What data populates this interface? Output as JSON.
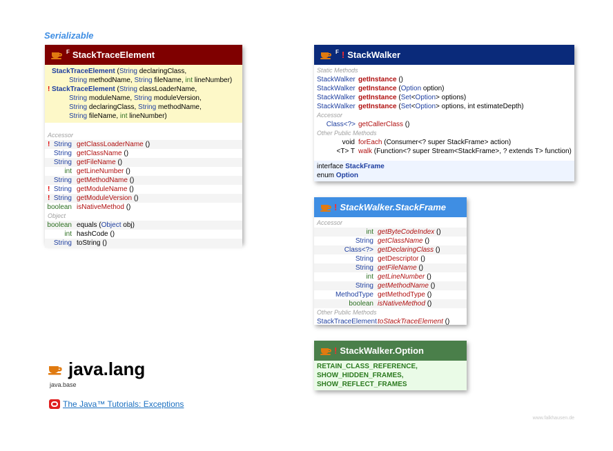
{
  "serializable_label": "Serializable",
  "icons": {
    "class": "coffee-cup-icon",
    "oracle": "oracle-logo-icon"
  },
  "colors": {
    "red_header": "#7f0000",
    "navy_header": "#0a2a7a",
    "blue_header": "#3f8ee3",
    "green_header": "#4a7f4a",
    "enum_bg": "#eafbe7",
    "ctor_bg": "#fdf8c8"
  },
  "stack_trace_element": {
    "modifier": "F",
    "title": "StackTraceElement",
    "constructors": [
      {
        "deprecated": "",
        "line1_name": "StackTraceElement",
        "line1_rest_a": " (",
        "line1_t1": "String",
        "line1_rest_b": " declaringClass,",
        "line2_t1": "String",
        "line2_a": " methodName, ",
        "line2_t2": "String",
        "line2_b": " fileName, ",
        "line2_t3": "int",
        "line2_c": " lineNumber)"
      },
      {
        "deprecated": "!",
        "line1_name": "StackTraceElement",
        "line1_rest_a": " (",
        "line1_t1": "String",
        "line1_rest_b": " classLoaderName,",
        "line2_t1": "String",
        "line2_a": " moduleName, ",
        "line2_t2": "String",
        "line2_b": " moduleVersion,",
        "line3_t1": "String",
        "line3_a": " declaringClass, ",
        "line3_t2": "String",
        "line3_b": " methodName,",
        "line4_t1": "String",
        "line4_a": " fileName, ",
        "line4_t2": "int",
        "line4_b": " lineNumber)"
      }
    ],
    "accessor_label": "Accessor",
    "accessors": [
      {
        "bang": "!",
        "type": "String",
        "name": "getClassLoaderName",
        "args": " ()"
      },
      {
        "bang": "",
        "type": "String",
        "name": "getClassName",
        "args": " ()"
      },
      {
        "bang": "",
        "type": "String",
        "name": "getFileName",
        "args": " ()"
      },
      {
        "bang": "",
        "type": "int",
        "name": "getLineNumber",
        "args": " ()"
      },
      {
        "bang": "",
        "type": "String",
        "name": "getMethodName",
        "args": " ()"
      },
      {
        "bang": "!",
        "type": "String",
        "name": "getModuleName",
        "args": " ()"
      },
      {
        "bang": "!",
        "type": "String",
        "name": "getModuleVersion",
        "args": " ()"
      },
      {
        "bang": "",
        "type": "boolean",
        "name": "isNativeMethod",
        "args": " ()"
      }
    ],
    "object_label": "Object",
    "object_methods": [
      {
        "type": "boolean",
        "name": "equals",
        "args_a": " (",
        "args_t": "Object",
        "args_b": " obj)"
      },
      {
        "type": "int",
        "name": "hashCode",
        "args_a": " ()",
        "args_t": "",
        "args_b": ""
      },
      {
        "type": "String",
        "name": "toString",
        "args_a": " ()",
        "args_t": "",
        "args_b": ""
      }
    ]
  },
  "stack_walker": {
    "modifier": "F",
    "bang": "!",
    "title": "StackWalker",
    "static_label": "Static Methods",
    "static_methods": [
      {
        "type": "StackWalker",
        "name": "getInstance",
        "a": " ()",
        "t1": "",
        "b": "",
        "t2": "",
        "c": ""
      },
      {
        "type": "StackWalker",
        "name": "getInstance",
        "a": " (",
        "t1": "Option",
        "b": " option)",
        "t2": "",
        "c": ""
      },
      {
        "type": "StackWalker",
        "name": "getInstance",
        "a": " (",
        "t1": "Set",
        "b": "<",
        "t2": "Option",
        "c": "> options)"
      },
      {
        "type": "StackWalker",
        "name": "getInstance",
        "a": " (",
        "t1": "Set",
        "b": "<",
        "t2": "Option",
        "c": "> options, int estimateDepth)"
      }
    ],
    "accessor_label": "Accessor",
    "accessor": {
      "type": "Class<?>",
      "name": "getCallerClass",
      "args": " ()"
    },
    "other_label": "Other Public Methods",
    "other_methods": [
      {
        "type": "void",
        "name": "forEach",
        "sig": " (Consumer<? super StackFrame> action)"
      },
      {
        "type": "<T> T",
        "name": "walk",
        "sig": " (Function<? super Stream<StackFrame>, ? extends T> function)"
      }
    ],
    "nested": [
      {
        "kw": "interface ",
        "name": "StackFrame"
      },
      {
        "kw": "enum ",
        "name": "Option"
      }
    ]
  },
  "stack_frame": {
    "bang": "!",
    "title": "StackWalker.StackFrame",
    "accessor_label": "Accessor",
    "accessors": [
      {
        "type": "int",
        "name": "getByteCodeIndex",
        "args": " ()",
        "italic": true
      },
      {
        "type": "String",
        "name": "getClassName",
        "args": " ()",
        "italic": true
      },
      {
        "type": "Class<?>",
        "name": "getDeclaringClass",
        "args": " ()",
        "italic": true
      },
      {
        "type": "String",
        "name": "getDescriptor",
        "args": " ()",
        "italic": false
      },
      {
        "type": "String",
        "name": "getFileName",
        "args": " ()",
        "italic": true
      },
      {
        "type": "int",
        "name": "getLineNumber",
        "args": " ()",
        "italic": true
      },
      {
        "type": "String",
        "name": "getMethodName",
        "args": " ()",
        "italic": true
      },
      {
        "type": "MethodType",
        "name": "getMethodType",
        "args": " ()",
        "italic": false
      },
      {
        "type": "boolean",
        "name": "isNativeMethod",
        "args": " ()",
        "italic": true
      }
    ],
    "other_label": "Other Public Methods",
    "other": {
      "type": "StackTraceElement",
      "name": "toStackTraceElement",
      "args": " ()"
    }
  },
  "option": {
    "bang": "!",
    "title": "StackWalker.Option",
    "constants": [
      "RETAIN_CLASS_REFERENCE,",
      "SHOW_HIDDEN_FRAMES,",
      "SHOW_REFLECT_FRAMES"
    ]
  },
  "package": {
    "name": "java.lang",
    "module": "java.base"
  },
  "tutorial_link": "The Java™ Tutorials: Exceptions",
  "credit": "www.falkhausen.de"
}
